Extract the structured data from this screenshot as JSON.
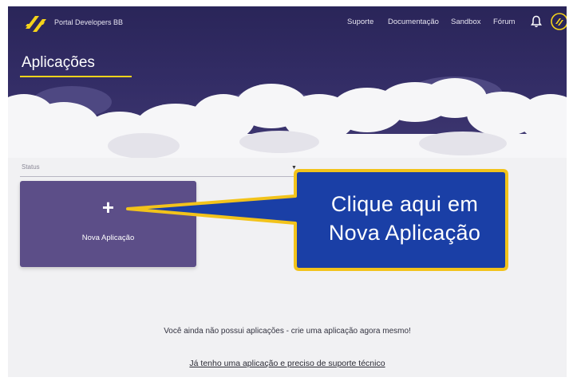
{
  "nav": {
    "brand": "Portal Developers BB",
    "links": [
      "Suporte",
      "Documentação",
      "Sandbox",
      "Fórum"
    ],
    "icons": [
      "bb-logo-icon",
      "bell-icon",
      "user-avatar-icon"
    ]
  },
  "page": {
    "title": "Aplicações"
  },
  "filter": {
    "status_label": "Status"
  },
  "new_app_card": {
    "label": "Nova Aplicação",
    "icon": "plus-icon"
  },
  "callout": {
    "line1": "Clique aqui em",
    "line2": "Nova Aplicação"
  },
  "empty_state": {
    "message": "Você ainda não possui aplicações - crie uma aplicação agora mesmo!",
    "support_link": "Já tenho uma aplicação e preciso de suporte técnico"
  },
  "colors": {
    "header_bg": "#2a2559",
    "brand_yellow": "#f5d31a",
    "card_bg": "#5c4e88",
    "callout_bg": "#1a3fa6",
    "callout_border": "#f2c31b"
  }
}
